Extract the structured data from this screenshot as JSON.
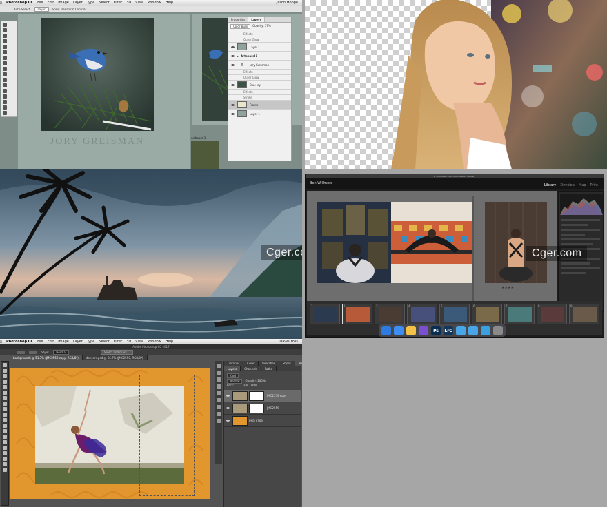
{
  "photoshop_top": {
    "menu": [
      "Photoshop CC",
      "File",
      "Edit",
      "Image",
      "Layer",
      "Type",
      "Select",
      "Filter",
      "3D",
      "View",
      "Window",
      "Help"
    ],
    "user": "Jason Hoppe",
    "options": {
      "auto_select": "Auto-Select:",
      "layer": "Layer",
      "transform": "Show Transform Controls"
    },
    "canvas_credit": "JORY GREISMAN",
    "artboard_label": "Artboard 3",
    "panel_tabs": [
      "Properties",
      "Layers"
    ],
    "blend": "Color Burn",
    "opacity": "Opacity: 37%",
    "layers": [
      {
        "name": "Effects",
        "kind": "sub"
      },
      {
        "name": "Outer Glow",
        "kind": "sub"
      },
      {
        "name": "Layer 1",
        "kind": "thumb"
      },
      {
        "name": "Artboard 1",
        "kind": "group"
      },
      {
        "name": "Jory Greisman",
        "kind": "text"
      },
      {
        "name": "Effects",
        "kind": "sub"
      },
      {
        "name": "Outer Glow",
        "kind": "sub"
      },
      {
        "name": "Blue jay",
        "kind": "thumb"
      },
      {
        "name": "Effects",
        "kind": "sub"
      },
      {
        "name": "Stroke",
        "kind": "sub"
      },
      {
        "name": "Frame",
        "kind": "thumb",
        "selected": true
      },
      {
        "name": "Layer 1",
        "kind": "thumb"
      }
    ]
  },
  "lightroom": {
    "user": "Ben Willmore",
    "title": "Lr Photoshop Lightroom Classic - Library",
    "modules": [
      "Library",
      "Develop",
      "Map",
      "Print"
    ],
    "active_module": "Library",
    "film_numbers": [
      "1",
      "2",
      "3",
      "4",
      "5",
      "6",
      "7",
      "8",
      "9"
    ],
    "dock": [
      {
        "label": "",
        "color": "#2d7be0",
        "name": "finder-icon"
      },
      {
        "label": "",
        "color": "#3c8ef2",
        "name": "safari-icon"
      },
      {
        "label": "",
        "color": "#f1c148",
        "name": "sketch-icon"
      },
      {
        "label": "",
        "color": "#7a4fd0",
        "name": "app-icon"
      },
      {
        "label": "Ps",
        "color": "#0a2d52",
        "name": "photoshop-icon"
      },
      {
        "label": "LrC",
        "color": "#13365a",
        "name": "lightroom-icon"
      },
      {
        "label": "",
        "color": "#48a6e8",
        "name": "folder-icon"
      },
      {
        "label": "",
        "color": "#48a6e8",
        "name": "folder-icon"
      },
      {
        "label": "",
        "color": "#3aa0e0",
        "name": "downloads-icon"
      },
      {
        "label": "",
        "color": "#8a8a8a",
        "name": "trash-icon"
      }
    ]
  },
  "watermark": "Cger.com",
  "photoshop_bottom": {
    "menu": [
      "Photoshop CC",
      "File",
      "Edit",
      "Image",
      "Layer",
      "Type",
      "Select",
      "Filter",
      "3D",
      "View",
      "Window",
      "Help"
    ],
    "user": "DaveCross",
    "app_title": "Adobe Photoshop CC 2017",
    "doc_tabs": [
      "backgrounds @ 51.3% (JMC2559 copy, RGB/8*)",
      "dancers.psd @ 66.7% (JMC2550, RGB/8*)"
    ],
    "style": "Normal",
    "select_mask": "Select and mask...",
    "panel_tabs_top": [
      "Libraries",
      "Color",
      "Swatches",
      "Styles",
      "Properties"
    ],
    "panel_tabs": [
      "Layers",
      "Channels",
      "Paths"
    ],
    "kind": "Kind",
    "blend": "Normal",
    "opacity": "Opacity: 100%",
    "fill": "Fill: 100%",
    "lock": "Lock:",
    "layers": [
      "JMC2559 copy",
      "JMC2559",
      "IMG_6763"
    ]
  }
}
